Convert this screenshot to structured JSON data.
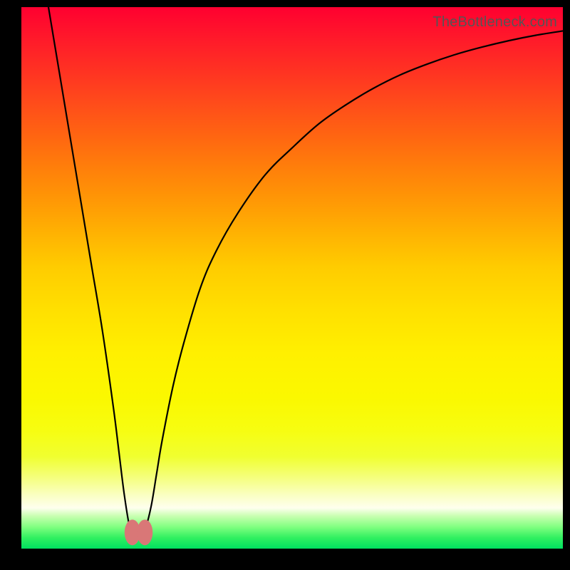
{
  "watermark": "TheBottleneck.com",
  "chart_data": {
    "type": "line",
    "title": "",
    "xlabel": "",
    "ylabel": "",
    "xlim": [
      0,
      100
    ],
    "ylim": [
      0,
      100
    ],
    "series": [
      {
        "name": "bottleneck-curve",
        "x": [
          5,
          7,
          9,
          11,
          13,
          15,
          17,
          18,
          19,
          20,
          21,
          22,
          23,
          24,
          25,
          26,
          28,
          30,
          33,
          36,
          40,
          45,
          50,
          55,
          60,
          65,
          70,
          75,
          80,
          85,
          90,
          95,
          100
        ],
        "values": [
          100,
          88,
          76,
          64,
          52,
          40,
          26,
          18,
          10,
          4,
          2,
          2,
          4,
          8,
          14,
          20,
          30,
          38,
          48,
          55,
          62,
          69,
          74,
          78.5,
          82,
          85,
          87.5,
          89.5,
          91.2,
          92.6,
          93.8,
          94.8,
          95.6
        ]
      }
    ],
    "markers": [
      {
        "name": "marker-left",
        "x": 20.5,
        "y": 3
      },
      {
        "name": "marker-right",
        "x": 22.8,
        "y": 3
      }
    ],
    "marker_color": "#d97777",
    "curve_color": "#000000",
    "background": "gradient-red-yellow-green"
  }
}
